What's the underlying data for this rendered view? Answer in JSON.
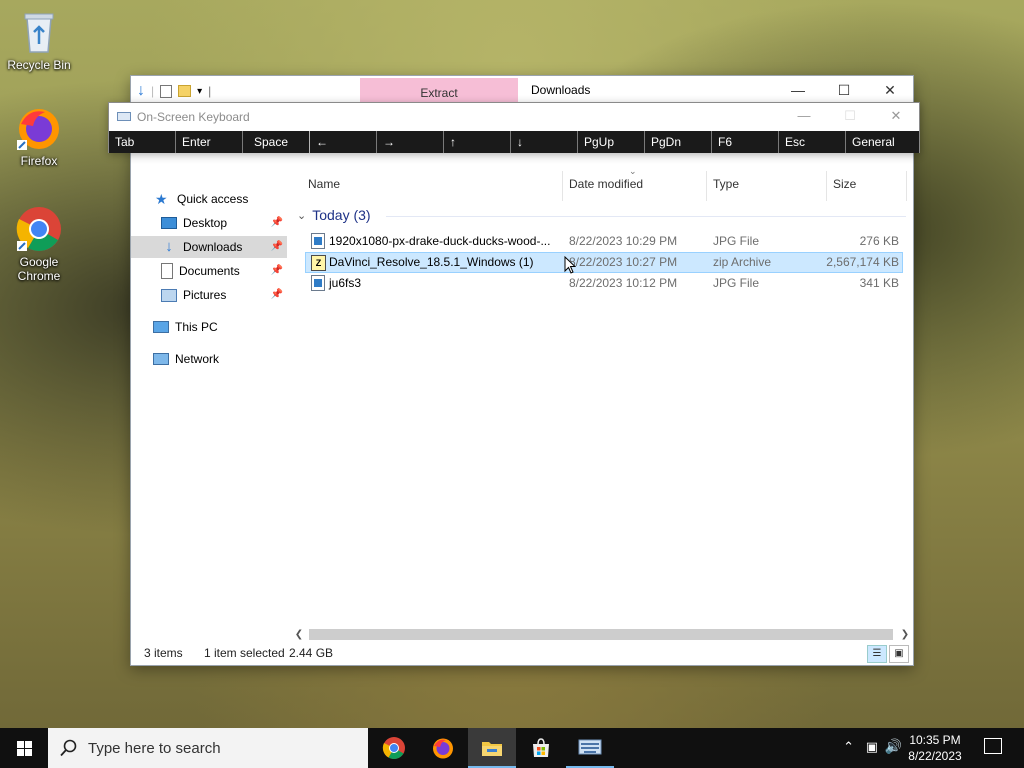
{
  "desktop": {
    "icons": [
      {
        "label": "Recycle Bin"
      },
      {
        "label": "Firefox"
      },
      {
        "label": "Google Chrome"
      }
    ]
  },
  "explorer": {
    "ribbon_tab_extract": "Extract",
    "title": "Downloads",
    "nav": {
      "quick_access": "Quick access",
      "desktop": "Desktop",
      "downloads": "Downloads",
      "documents": "Documents",
      "pictures": "Pictures",
      "this_pc": "This PC",
      "network": "Network"
    },
    "columns": {
      "name": "Name",
      "date_modified": "Date modified",
      "type": "Type",
      "size": "Size"
    },
    "group": "Today (3)",
    "files": [
      {
        "name": "1920x1080-px-drake-duck-ducks-wood-...",
        "date": "8/22/2023 10:29 PM",
        "type": "JPG File",
        "size": "276 KB"
      },
      {
        "name": "DaVinci_Resolve_18.5.1_Windows (1)",
        "date": "8/22/2023 10:27 PM",
        "type": "zip Archive",
        "size": "2,567,174 KB"
      },
      {
        "name": "ju6fs3",
        "date": "8/22/2023 10:12 PM",
        "type": "JPG File",
        "size": "341 KB"
      }
    ],
    "status": {
      "items": "3 items",
      "selected": "1 item selected",
      "size": "2.44 GB"
    }
  },
  "osk": {
    "title": "On-Screen Keyboard",
    "keys": [
      "Tab",
      "Enter",
      "Space",
      "←",
      "→",
      "↑",
      "↓",
      "PgUp",
      "PgDn",
      "F6",
      "Esc",
      "General"
    ]
  },
  "taskbar": {
    "search_placeholder": "Type here to search",
    "time": "10:35 PM",
    "date": "8/22/2023"
  }
}
